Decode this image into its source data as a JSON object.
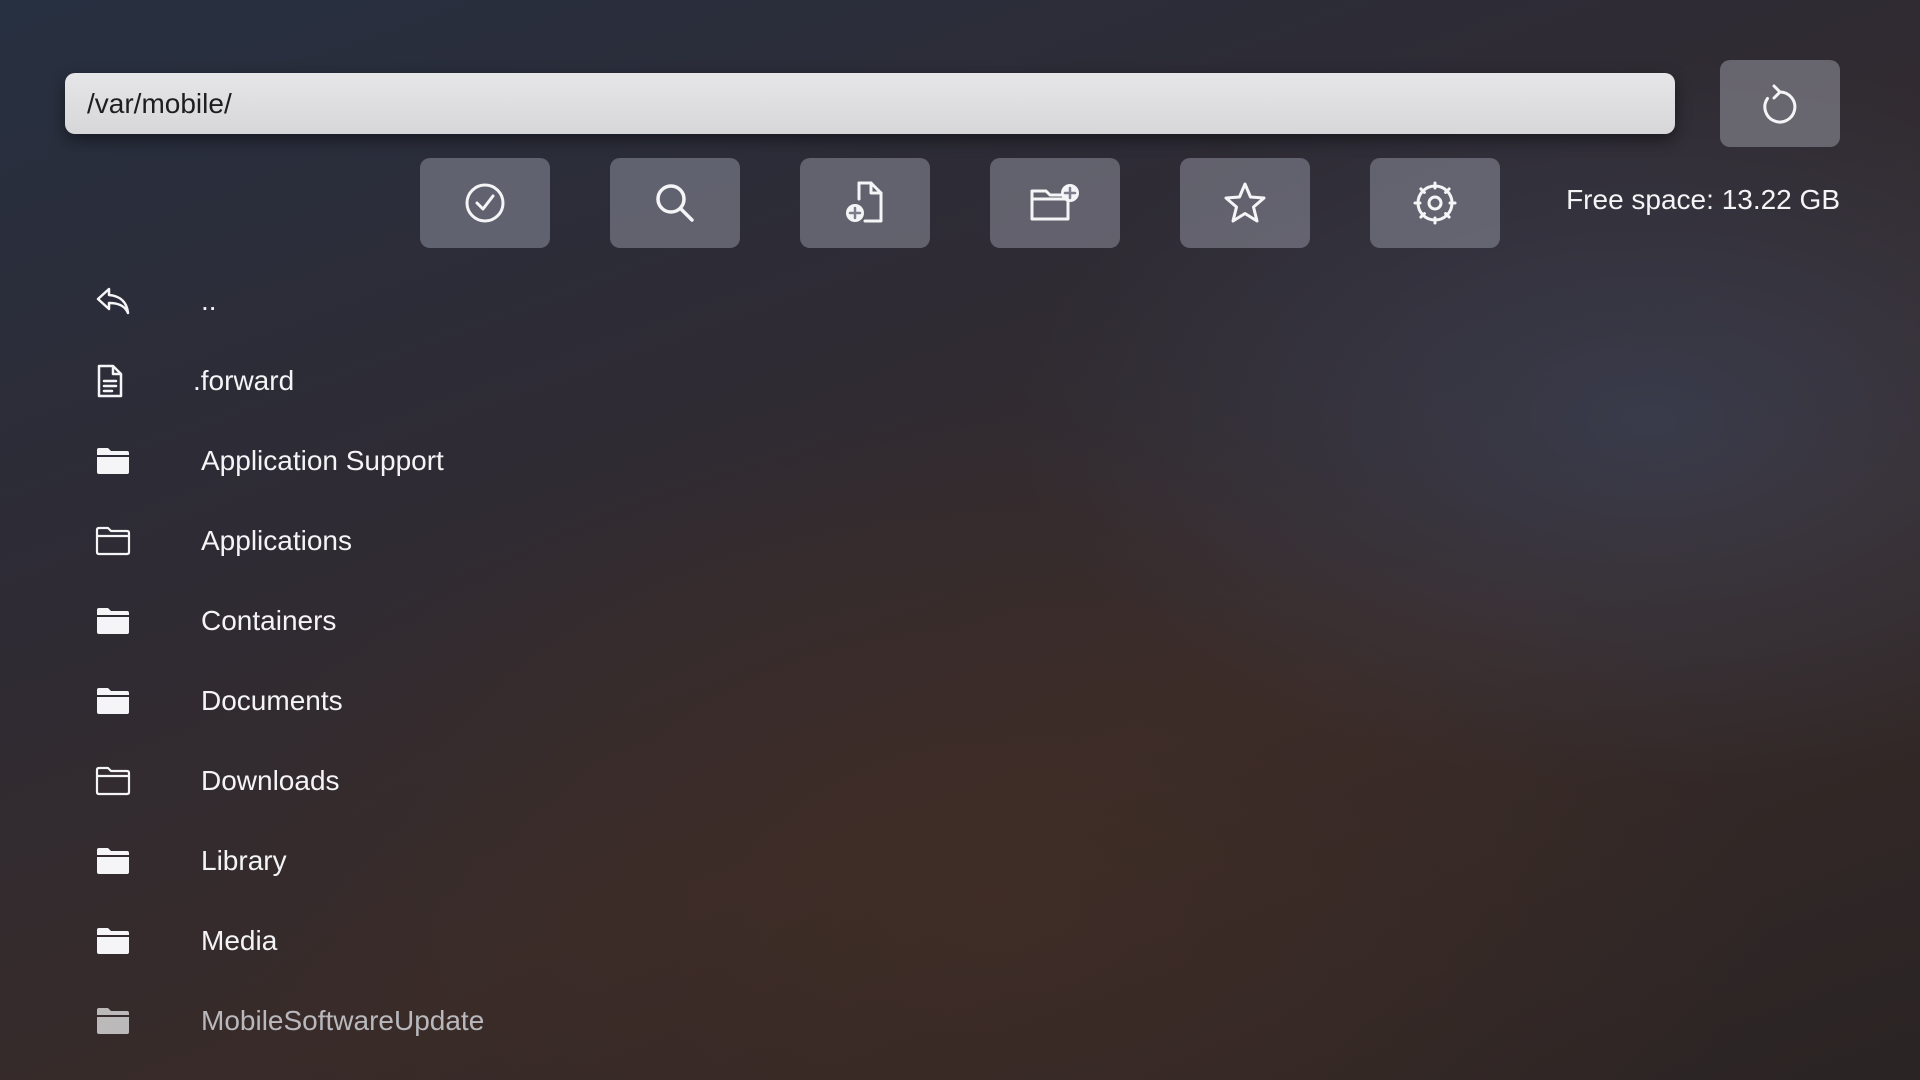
{
  "path_bar": {
    "value": "/var/mobile/"
  },
  "toolbar": {
    "buttons": [
      {
        "name": "select",
        "icon": "checkmark-circle-icon"
      },
      {
        "name": "search",
        "icon": "search-icon"
      },
      {
        "name": "new-file",
        "icon": "new-file-icon"
      },
      {
        "name": "new-folder",
        "icon": "new-folder-icon"
      },
      {
        "name": "favorites",
        "icon": "star-icon"
      },
      {
        "name": "settings",
        "icon": "gear-icon"
      }
    ],
    "refresh_icon": "refresh-icon"
  },
  "free_space": "Free space: 13.22 GB",
  "files": [
    {
      "name": "..",
      "icon": "back-arrow-icon"
    },
    {
      "name": ".forward",
      "icon": "document-icon"
    },
    {
      "name": "Application Support",
      "icon": "folder-filled-icon"
    },
    {
      "name": "Applications",
      "icon": "folder-outline-icon"
    },
    {
      "name": "Containers",
      "icon": "folder-filled-icon"
    },
    {
      "name": "Documents",
      "icon": "folder-filled-icon"
    },
    {
      "name": "Downloads",
      "icon": "folder-outline-icon"
    },
    {
      "name": "Library",
      "icon": "folder-filled-icon"
    },
    {
      "name": "Media",
      "icon": "folder-filled-icon"
    },
    {
      "name": "MobileSoftwareUpdate",
      "icon": "folder-filled-icon"
    }
  ]
}
